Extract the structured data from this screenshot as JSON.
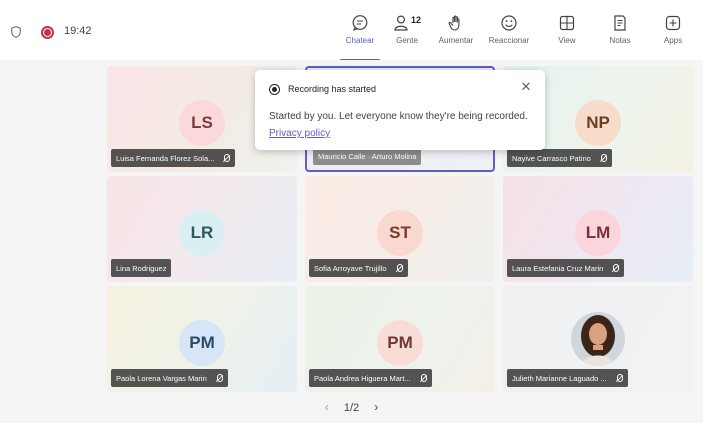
{
  "call": {
    "timer": "19:42"
  },
  "toolbar": {
    "items": [
      {
        "label": "Chatear",
        "icon": "chat-icon"
      },
      {
        "label": "Gente",
        "icon": "people-icon",
        "count": "12"
      },
      {
        "label": "Aumentar",
        "icon": "raise-hand-icon"
      },
      {
        "label": "Reaccionar",
        "icon": "react-icon"
      },
      {
        "label": "View",
        "icon": "view-icon"
      },
      {
        "label": "Notas",
        "icon": "notes-icon"
      },
      {
        "label": "Apps",
        "icon": "apps-icon"
      }
    ],
    "active_index": 0
  },
  "toast": {
    "title": "Recording has started",
    "body": "Started by you. Let everyone know they're being recorded.",
    "link": "Privacy policy"
  },
  "participants": [
    {
      "initials": "LS",
      "name": "Luisa Fernanda Florez Sola..."
    },
    {
      "initials": "",
      "name": "Mauricio Calle · Arturo Molina"
    },
    {
      "initials": "NP",
      "name": "Nayive Carrasco Patino"
    },
    {
      "initials": "LR",
      "name": "Lina Rodriguez"
    },
    {
      "initials": "ST",
      "name": "Sofia Arroyave Trujillo"
    },
    {
      "initials": "LM",
      "name": "Laura Estefania Cruz Marin"
    },
    {
      "initials": "PM",
      "name": "Paola Lorena Vargas Marin"
    },
    {
      "initials": "PM",
      "name": "Paola Andrea Higuera Mart..."
    },
    {
      "initials": "",
      "name": "Julieth Marianne Laguado ..."
    }
  ],
  "pager": {
    "text": "1/2"
  },
  "colors": {
    "accent": "#5b5fc7",
    "recording": "#c4314b"
  }
}
